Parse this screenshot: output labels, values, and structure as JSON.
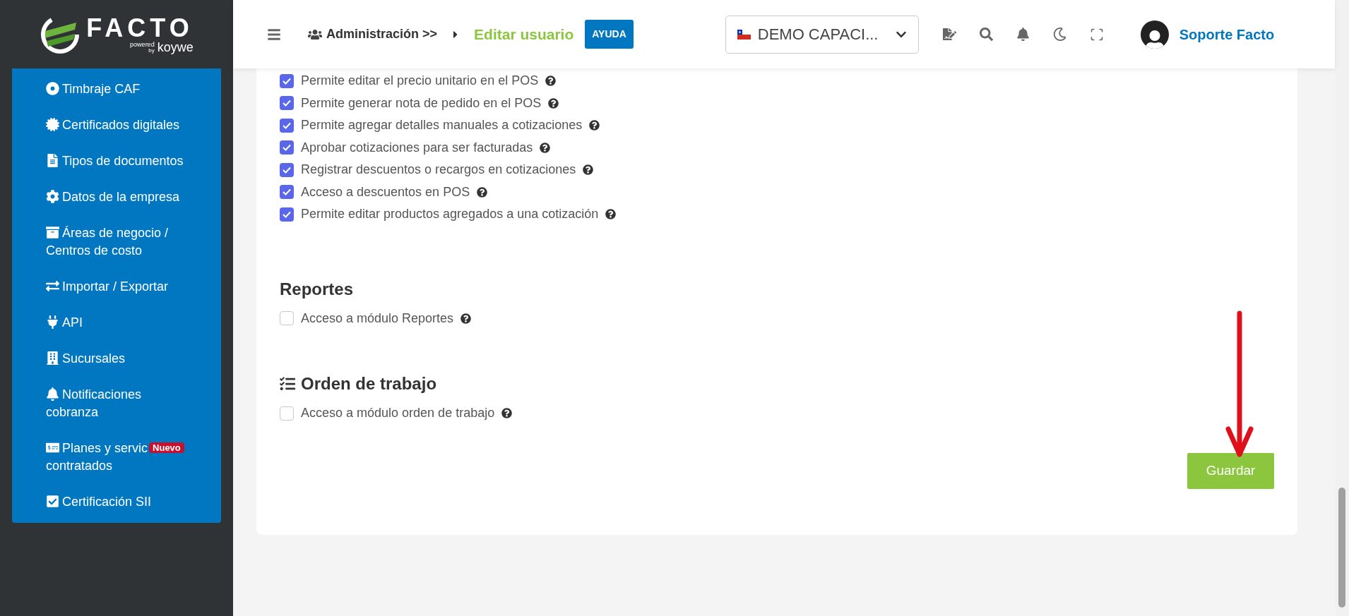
{
  "sidebar": {
    "logo": {
      "name": "FACTO",
      "powered": "powered",
      "by": "by",
      "brand": "koywe"
    },
    "items": [
      {
        "label": "Timbraje CAF"
      },
      {
        "label": "Certificados digitales"
      },
      {
        "label": "Tipos de documentos"
      },
      {
        "label": "Datos de la empresa"
      },
      {
        "label": "Áreas de negocio / Centros de costo"
      },
      {
        "label": "Importar / Exportar"
      },
      {
        "label": "API"
      },
      {
        "label": "Sucursales"
      },
      {
        "label": "Notificaciones cobranza"
      },
      {
        "label": "Planes y servic",
        "badge": "Nuevo",
        "continuation": "contratados"
      },
      {
        "label": "Certificación SII"
      }
    ]
  },
  "header": {
    "breadcrumb": {
      "parent": "Administración >>",
      "current": "Editar usuario"
    },
    "help_button": "AYUDA",
    "company_select": {
      "value": "DEMO CAPACI..."
    },
    "user": {
      "name": "Soporte Facto"
    }
  },
  "permissions": [
    {
      "label": "Permite editar el precio unitario en el POS",
      "checked": true
    },
    {
      "label": "Permite generar nota de pedido en el POS",
      "checked": true
    },
    {
      "label": "Permite agregar detalles manuales a cotizaciones",
      "checked": true
    },
    {
      "label": "Aprobar cotizaciones para ser facturadas",
      "checked": true
    },
    {
      "label": "Registrar descuentos o recargos en cotizaciones",
      "checked": true
    },
    {
      "label": "Acceso a descuentos en POS",
      "checked": true
    },
    {
      "label": "Permite editar productos agregados a una cotización",
      "checked": true
    }
  ],
  "sections": [
    {
      "kind": "plain",
      "title": "Reportes",
      "items": [
        {
          "label": "Acceso a módulo Reportes",
          "checked": false
        }
      ]
    },
    {
      "kind": "with_icon",
      "title": "Orden de trabajo",
      "items": [
        {
          "label": "Acceso a módulo orden de trabajo",
          "checked": false
        }
      ]
    }
  ],
  "save_button": "Guardar"
}
